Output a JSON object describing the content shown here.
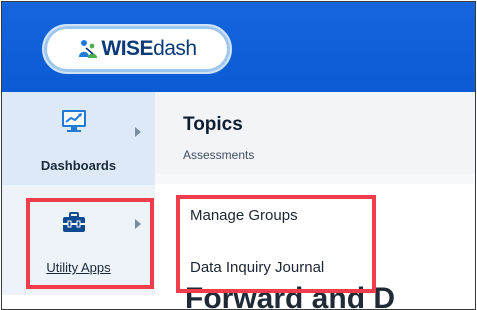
{
  "app": {
    "logo_wise": "WISE",
    "logo_dash": "dash"
  },
  "sidebar": {
    "items": [
      {
        "label": "Dashboards",
        "icon": "chart-monitor-icon"
      },
      {
        "label": "Utility Apps",
        "icon": "toolbox-icon"
      }
    ]
  },
  "panel": {
    "title": "Topics",
    "subtitle": "Assessments",
    "menu": [
      {
        "label": "Manage Groups"
      },
      {
        "label": "Data Inquiry Journal"
      }
    ],
    "background_text": "Forward and D"
  },
  "colors": {
    "brand_blue": "#0b5bd5",
    "highlight_red": "#ef3d4b",
    "active_bg": "#dde9f7"
  }
}
